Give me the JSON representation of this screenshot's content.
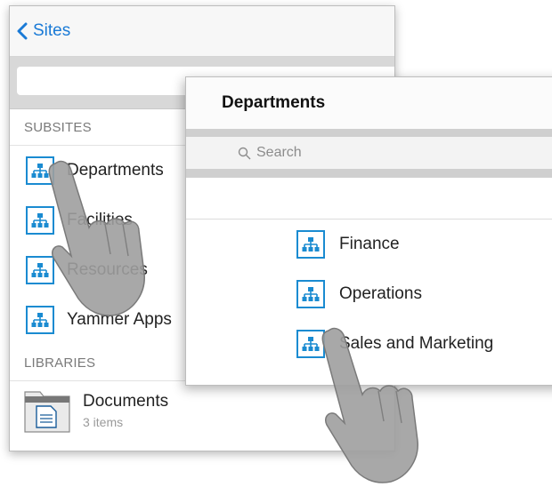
{
  "back_panel": {
    "back_label": "Sites",
    "subsites_header": "SUBSITES",
    "subsites": [
      "Departments",
      "Facilities",
      "Resources",
      "Yammer Apps"
    ],
    "libraries_header": "LIBRARIES",
    "library": {
      "name": "Documents",
      "meta": "3 items"
    }
  },
  "front_panel": {
    "title": "Departments",
    "search_placeholder": "Search",
    "items": [
      "Finance",
      "Operations",
      "Sales and Marketing"
    ]
  },
  "colors": {
    "accent": "#1a7ad6",
    "site_icon": "#1a8bd1"
  },
  "icons": [
    "chevron-left-icon",
    "site-hierarchy-icon",
    "folder-icon",
    "document-icon",
    "search-icon",
    "hand-pointer-icon"
  ]
}
